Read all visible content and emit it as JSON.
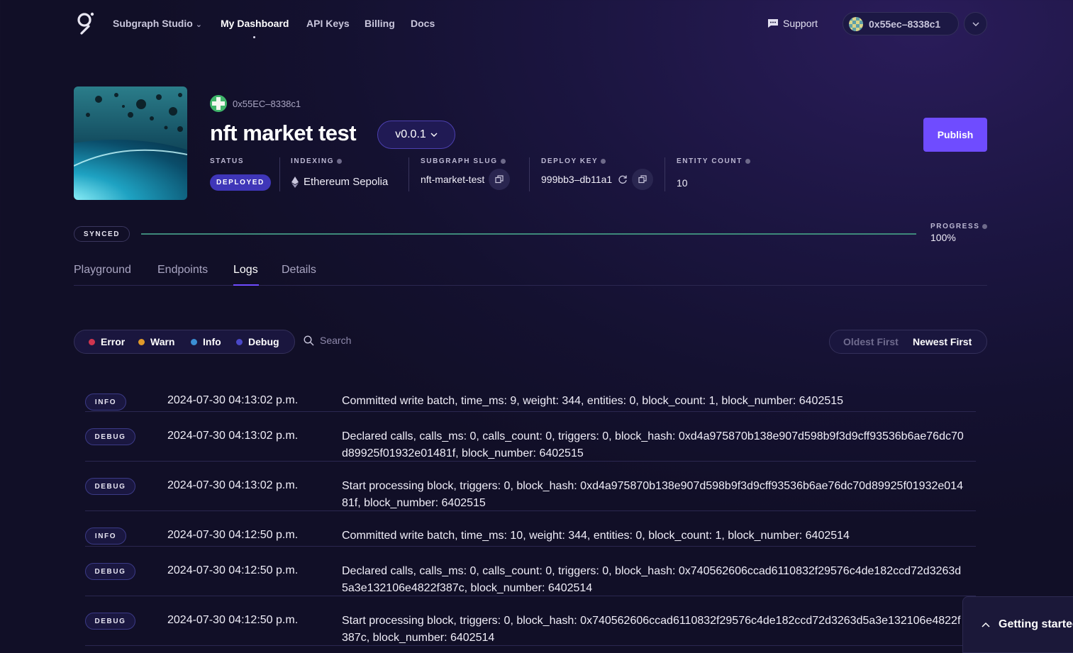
{
  "nav": {
    "brand": "Subgraph Studio",
    "items": [
      {
        "label": "My Dashboard",
        "active": true
      },
      {
        "label": "API Keys",
        "active": false
      },
      {
        "label": "Billing",
        "active": false
      },
      {
        "label": "Docs",
        "active": false
      }
    ],
    "support": "Support",
    "wallet": "0x55ec–8338c1",
    "icons": {
      "logo": "graph-logo-icon",
      "support": "chat-icon",
      "menu": "chevron-down-icon"
    }
  },
  "subgraph": {
    "owner": "0x55EC–8338c1",
    "name": "nft market test",
    "version": "v0.0.1",
    "publish_label": "Publish",
    "meta": {
      "status_label": "STATUS",
      "status": "DEPLOYED",
      "indexing_label": "INDEXING",
      "network": "Ethereum Sepolia",
      "slug_label": "SUBGRAPH SLUG",
      "slug": "nft-market-test",
      "deploy_key_label": "DEPLOY KEY",
      "deploy_key": "999bb3–db11a1",
      "entity_count_label": "ENTITY COUNT",
      "entity_count": "10"
    }
  },
  "sync": {
    "status": "SYNCED",
    "progress_label": "PROGRESS",
    "progress_value": "100%",
    "progress_fraction": 1.0
  },
  "tabs": [
    {
      "label": "Playground",
      "active": false
    },
    {
      "label": "Endpoints",
      "active": false
    },
    {
      "label": "Logs",
      "active": true
    },
    {
      "label": "Details",
      "active": false
    }
  ],
  "filters": {
    "levels": [
      {
        "label": "Error",
        "color": "#d0354f"
      },
      {
        "label": "Warn",
        "color": "#e09a2a"
      },
      {
        "label": "Info",
        "color": "#3b8fd4"
      },
      {
        "label": "Debug",
        "color": "#4a48c8"
      }
    ],
    "search_placeholder": "Search",
    "sort": {
      "oldest": "Oldest First",
      "newest": "Newest First",
      "selected": "Newest First"
    }
  },
  "logs": [
    {
      "level": "INFO",
      "time": "2024-07-30 04:13:02 p.m.",
      "message": "Committed write batch, time_ms: 9, weight: 344, entities: 0, block_count: 1, block_number: 6402515"
    },
    {
      "level": "DEBUG",
      "time": "2024-07-30 04:13:02 p.m.",
      "message": "Declared calls, calls_ms: 0, calls_count: 0, triggers: 0, block_hash: 0xd4a975870b138e907d598b9f3d9cff93536b6ae76dc70d89925f01932e01481f, block_number: 6402515"
    },
    {
      "level": "DEBUG",
      "time": "2024-07-30 04:13:02 p.m.",
      "message": "Start processing block, triggers: 0, block_hash: 0xd4a975870b138e907d598b9f3d9cff93536b6ae76dc70d89925f01932e01481f, block_number: 6402515"
    },
    {
      "level": "INFO",
      "time": "2024-07-30 04:12:50 p.m.",
      "message": "Committed write batch, time_ms: 10, weight: 344, entities: 0, block_count: 1, block_number: 6402514"
    },
    {
      "level": "DEBUG",
      "time": "2024-07-30 04:12:50 p.m.",
      "message": "Declared calls, calls_ms: 0, calls_count: 0, triggers: 0, block_hash: 0x740562606ccad6110832f29576c4de182ccd72d3263d5a3e132106e4822f387c, block_number: 6402514"
    },
    {
      "level": "DEBUG",
      "time": "2024-07-30 04:12:50 p.m.",
      "message": "Start processing block, triggers: 0, block_hash: 0x740562606ccad6110832f29576c4de182ccd72d3263d5a3e132106e4822f387c, block_number: 6402514"
    }
  ],
  "getting_started": "Getting started"
}
